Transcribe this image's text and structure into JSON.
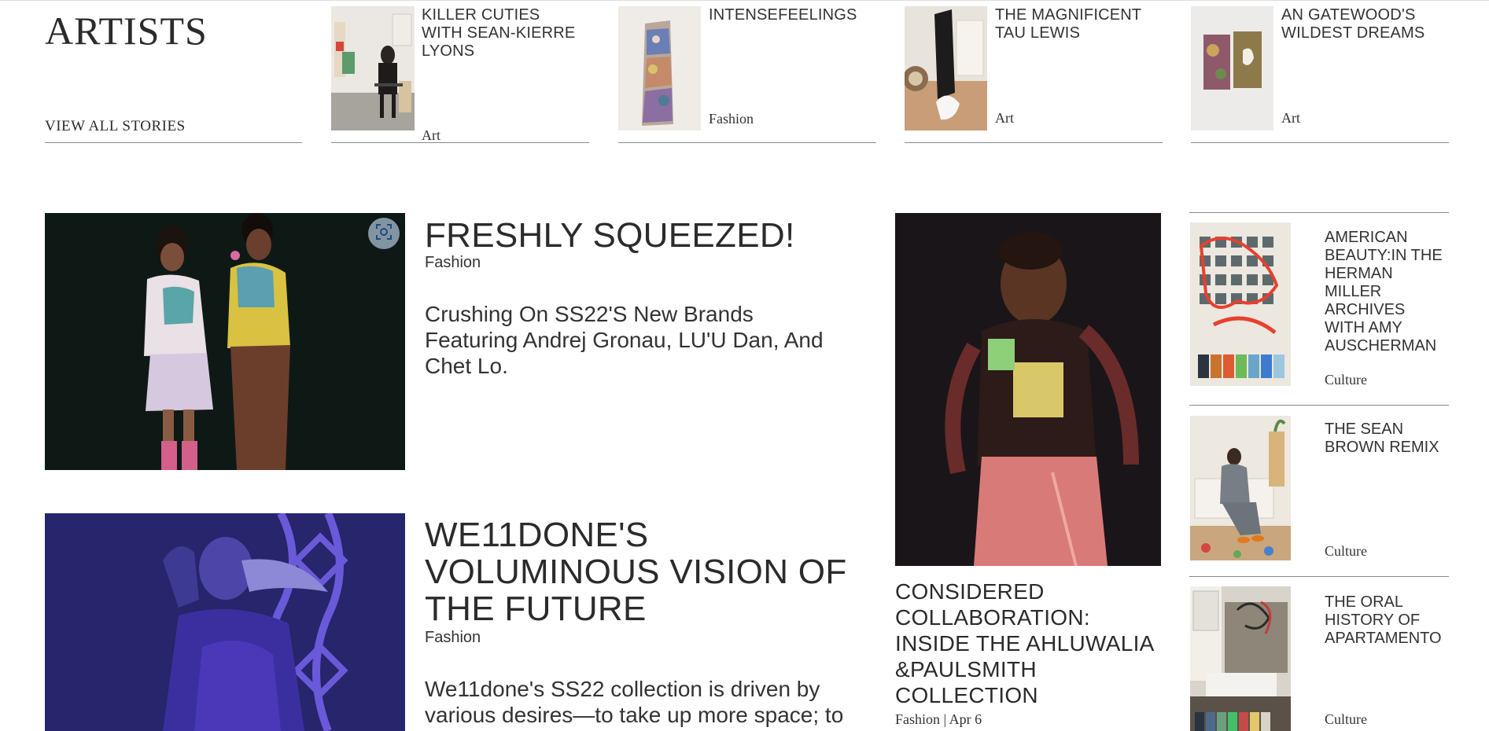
{
  "section": {
    "title": "ARTISTS",
    "view_all": "VIEW ALL STORIES"
  },
  "top_cards": [
    {
      "title": "KILLER CUTIES WITH SEAN-KIERRE LYONS",
      "tag": "Art"
    },
    {
      "title": "INTENSEFEELINGS",
      "tag": "Fashion"
    },
    {
      "title": "THE MAGNIFICENT TAU LEWIS",
      "tag": "Art"
    },
    {
      "title": "AN GATEWOOD'S WILDEST DREAMS",
      "tag": "Art"
    }
  ],
  "features": [
    {
      "title": "FRESHLY SQUEEZED!",
      "tag": "Fashion",
      "description": "Crushing On SS22'S New Brands Featuring Andrej Gronau, LU'U Dan, And Chet Lo."
    },
    {
      "title": "WE11DONE'S VOLUMINOUS VISION OF THE FUTURE",
      "tag": "Fashion",
      "description": "We11done's SS22 collection is driven by various desires—to take up more space; to"
    }
  ],
  "middle_story": {
    "title": "CONSIDERED COLLABORATION: INSIDE THE AHLUWALIA &PAULSMITH COLLECTION",
    "meta": "Fashion | Apr 6"
  },
  "side_stories": [
    {
      "title": "AMERICAN BEAUTY:IN THE HERMAN MILLER ARCHIVES WITH AMY AUSCHERMAN",
      "tag": "Culture"
    },
    {
      "title": "THE SEAN BROWN REMIX",
      "tag": "Culture"
    },
    {
      "title": "THE ORAL HISTORY OF APARTAMENTO",
      "tag": "Culture"
    }
  ],
  "icons": {
    "scan": "scan-icon"
  },
  "colors": {
    "text": "#2b2b2b",
    "rule": "#8a8a8a",
    "background": "#ffffff"
  }
}
